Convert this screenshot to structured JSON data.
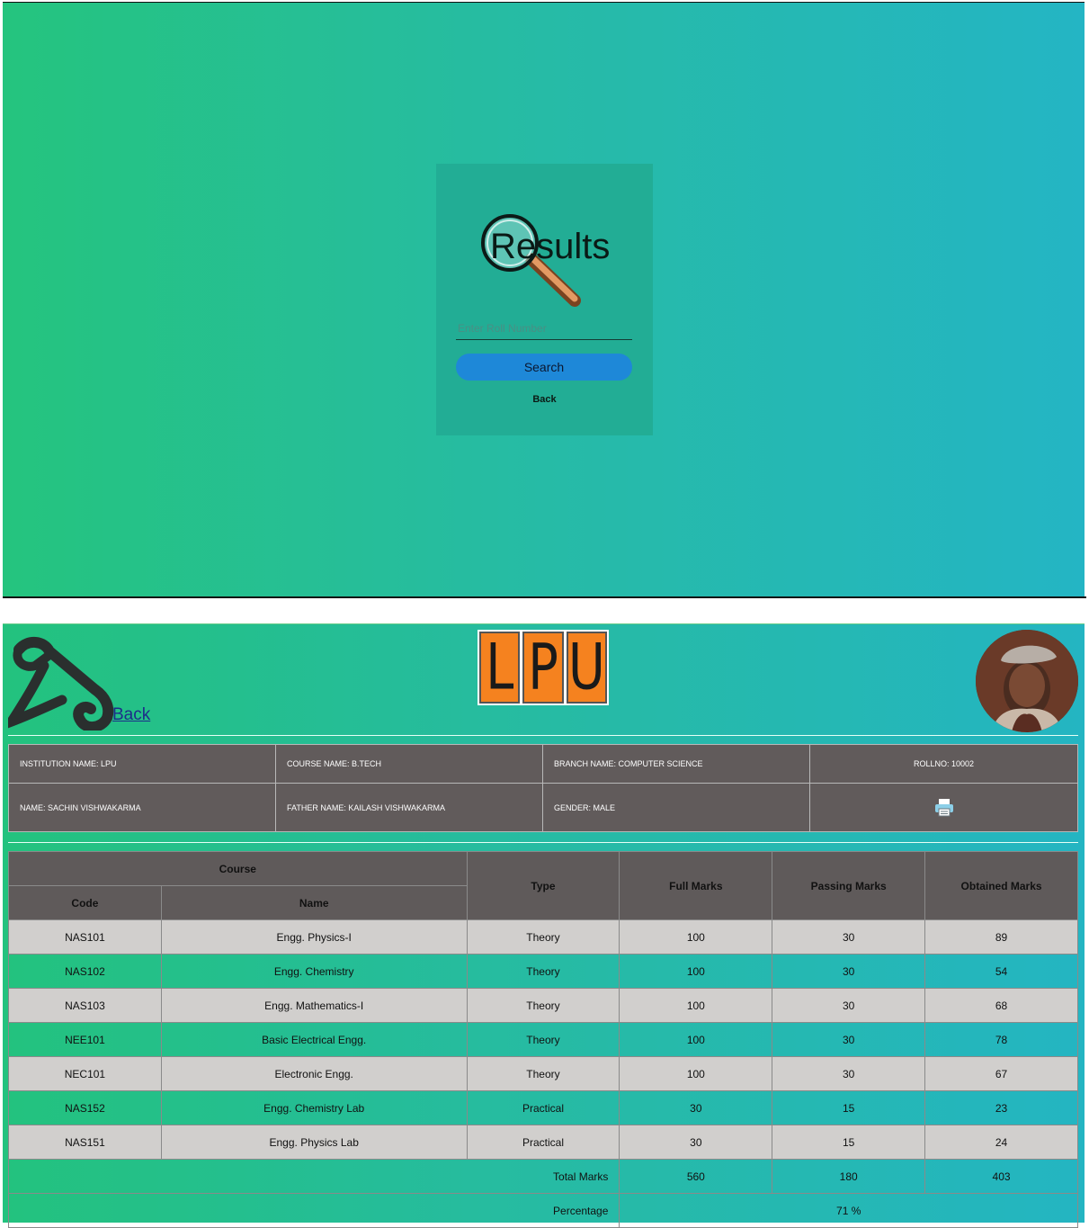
{
  "search_screen": {
    "logo_text": "Results",
    "roll_input_placeholder": "Enter Roll Number",
    "search_button_label": "Search",
    "back_link_label": "Back"
  },
  "result_screen": {
    "back_link_label": "Back",
    "lpu_logo_letters": [
      "L",
      "P",
      "U"
    ],
    "student_info": {
      "institution": "INSTITUTION NAME: LPU",
      "course": "COURSE NAME: B.TECH",
      "branch": "BRANCH NAME: COMPUTER SCIENCE",
      "rollno": "ROLLNO: 10002",
      "name": "NAME: SACHIN VISHWAKARMA",
      "father": "FATHER NAME: KAILASH VISHWAKARMA",
      "gender": "GENDER: MALE",
      "print_icon": "printer-icon"
    },
    "marks_table": {
      "headers": {
        "course": "Course",
        "code": "Code",
        "name": "Name",
        "type": "Type",
        "full_marks": "Full Marks",
        "passing_marks": "Passing Marks",
        "obtained_marks": "Obtained Marks"
      },
      "rows": [
        {
          "code": "NAS101",
          "name": "Engg. Physics-I",
          "type": "Theory",
          "full": "100",
          "passing": "30",
          "obtained": "89"
        },
        {
          "code": "NAS102",
          "name": "Engg. Chemistry",
          "type": "Theory",
          "full": "100",
          "passing": "30",
          "obtained": "54"
        },
        {
          "code": "NAS103",
          "name": "Engg. Mathematics-I",
          "type": "Theory",
          "full": "100",
          "passing": "30",
          "obtained": "68"
        },
        {
          "code": "NEE101",
          "name": "Basic Electrical Engg.",
          "type": "Theory",
          "full": "100",
          "passing": "30",
          "obtained": "78"
        },
        {
          "code": "NEC101",
          "name": "Electronic Engg.",
          "type": "Theory",
          "full": "100",
          "passing": "30",
          "obtained": "67"
        },
        {
          "code": "NAS152",
          "name": "Engg. Chemistry Lab",
          "type": "Practical",
          "full": "30",
          "passing": "15",
          "obtained": "23"
        },
        {
          "code": "NAS151",
          "name": "Engg. Physics Lab",
          "type": "Practical",
          "full": "30",
          "passing": "15",
          "obtained": "24"
        }
      ],
      "total": {
        "label": "Total Marks",
        "full": "560",
        "passing": "180",
        "obtained": "403"
      },
      "percentage": {
        "label": "Percentage",
        "value": "71 %"
      }
    }
  }
}
